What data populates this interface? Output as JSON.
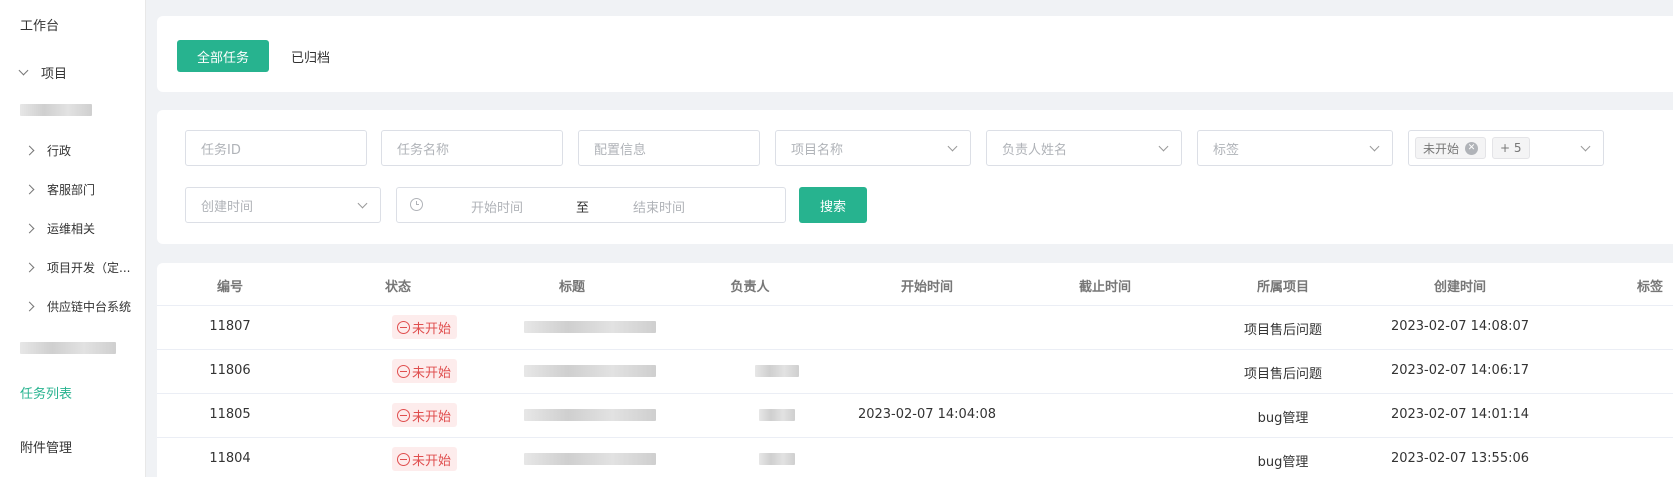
{
  "sidebar": {
    "workbench": "工作台",
    "project": "项目",
    "items": [
      {
        "label": "行政"
      },
      {
        "label": "客服部门"
      },
      {
        "label": "运维相关"
      },
      {
        "label": "项目开发（定..."
      },
      {
        "label": "供应链中台系统"
      }
    ],
    "task_list": "任务列表",
    "attachments": "附件管理"
  },
  "tabs": {
    "all": "全部任务",
    "archived": "已归档"
  },
  "filters": {
    "task_id": "任务ID",
    "task_name": "任务名称",
    "config_info": "配置信息",
    "project_name": "项目名称",
    "assignee_name": "负责人姓名",
    "tag": "标签",
    "status_tag": "未开始",
    "status_more": "+ 5",
    "created_time": "创建时间",
    "start_time": "开始时间",
    "range_sep": "至",
    "end_time": "结束时间",
    "search": "搜索"
  },
  "table": {
    "columns": [
      "编号",
      "状态",
      "标题",
      "负责人",
      "开始时间",
      "截止时间",
      "所属项目",
      "创建时间",
      "标签"
    ],
    "rows": [
      {
        "id": "11807",
        "status": "未开始",
        "start": "",
        "deadline": "",
        "project": "项目售后问题",
        "created": "2023-02-07 14:08:07"
      },
      {
        "id": "11806",
        "status": "未开始",
        "start": "",
        "deadline": "",
        "project": "项目售后问题",
        "created": "2023-02-07 14:06:17"
      },
      {
        "id": "11805",
        "status": "未开始",
        "start": "2023-02-07 14:04:08",
        "deadline": "",
        "project": "bug管理",
        "created": "2023-02-07 14:01:14"
      },
      {
        "id": "11804",
        "status": "未开始",
        "start": "",
        "deadline": "",
        "project": "bug管理",
        "created": "2023-02-07 13:55:06"
      }
    ]
  },
  "colors": {
    "accent": "#27b38f",
    "status_red": "#e04f4f"
  }
}
